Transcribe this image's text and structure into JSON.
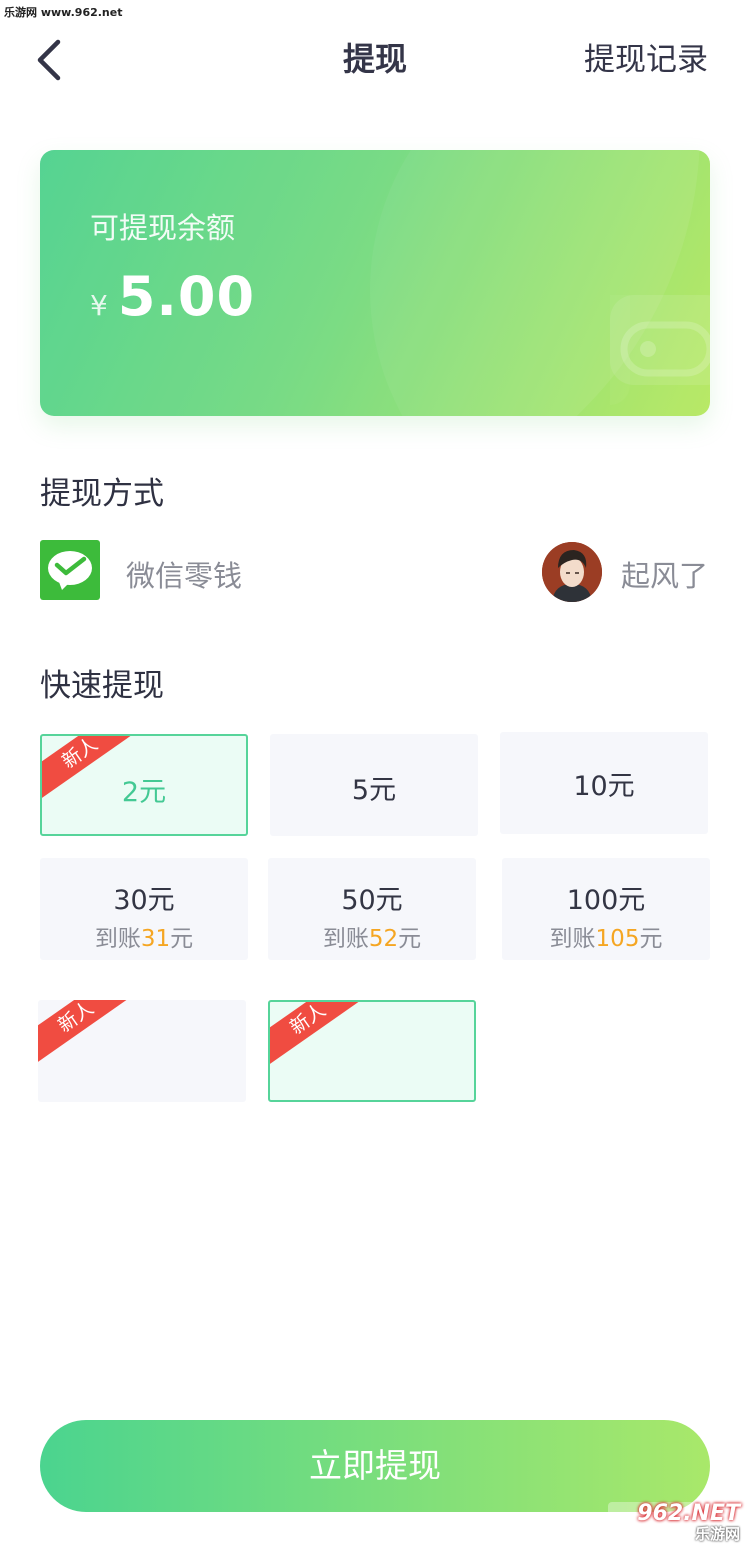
{
  "watermark": {
    "top_left": "乐游网 www.962.net",
    "bottom_brand": "962.NET",
    "bottom_cn": "乐游网"
  },
  "header": {
    "title": "提现",
    "record_link": "提现记录"
  },
  "balance": {
    "label": "可提现余额",
    "currency": "¥",
    "amount": "5.00"
  },
  "method": {
    "section_title": "提现方式",
    "wechat_label": "微信零钱",
    "user_name": "起风了"
  },
  "quick": {
    "section_title": "快速提现",
    "new_badge": "新人",
    "options": [
      {
        "label": "2元",
        "badge": true,
        "selected": true
      },
      {
        "label": "5元"
      },
      {
        "label": "10元"
      },
      {
        "label": "30元",
        "sub_prefix": "到账",
        "sub_amount": "31",
        "sub_suffix": "元"
      },
      {
        "label": "50元",
        "sub_prefix": "到账",
        "sub_amount": "52",
        "sub_suffix": "元"
      },
      {
        "label": "100元",
        "sub_prefix": "到账",
        "sub_amount": "105",
        "sub_suffix": "元"
      },
      {
        "label": "",
        "badge": true
      },
      {
        "label": "",
        "badge": true,
        "selected": true
      }
    ]
  },
  "submit": {
    "label": "立即提现"
  },
  "colors": {
    "accent_green": "#4bd48f",
    "accent_lime": "#b6e85e",
    "badge_red": "#f04c41",
    "bonus_orange": "#f5a623",
    "wechat_green": "#3dbb3b"
  }
}
